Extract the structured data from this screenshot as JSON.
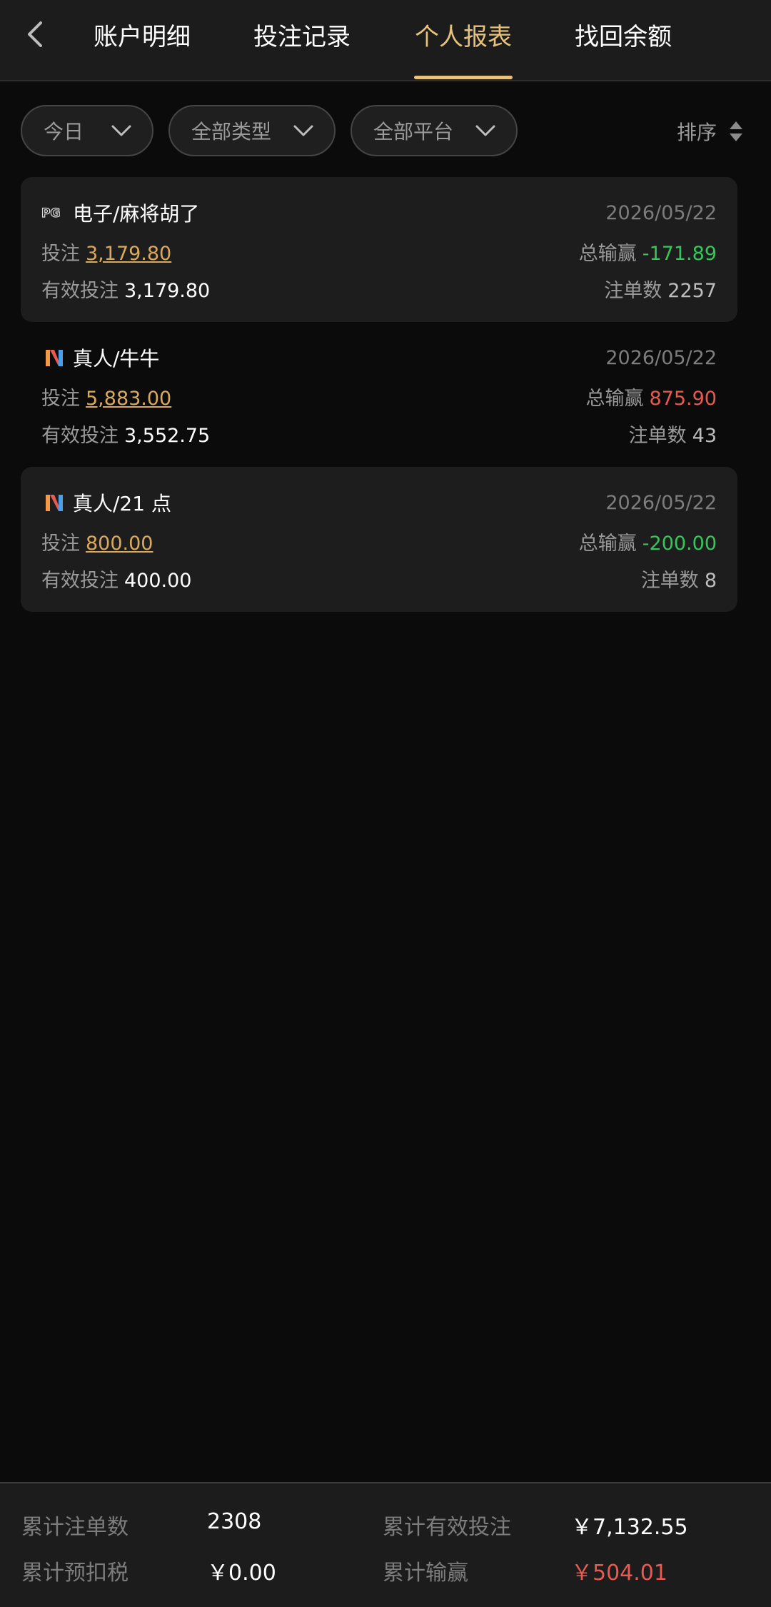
{
  "header": {
    "tabs": [
      {
        "label": "账户明细",
        "active": false
      },
      {
        "label": "投注记录",
        "active": false
      },
      {
        "label": "个人报表",
        "active": true
      },
      {
        "label": "找回余额",
        "active": false
      }
    ]
  },
  "filters": {
    "date": "今日",
    "type": "全部类型",
    "platform": "全部平台",
    "sort": "排序"
  },
  "labels": {
    "bet": "投注",
    "valid_bet": "有效投注",
    "total_win_loss": "总输赢",
    "order_count": "注单数"
  },
  "records": [
    {
      "icon": "pg-logo-icon",
      "game": "电子/麻将胡了",
      "date": "2026/05/22",
      "bet": "3,179.80",
      "valid_bet": "3,179.80",
      "win_loss": "-171.89",
      "win_loss_color": "#34c759",
      "order_count": "2257"
    },
    {
      "icon": "m-logo-icon",
      "game": "真人/牛牛",
      "date": "2026/05/22",
      "bet": "5,883.00",
      "valid_bet": "3,552.75",
      "win_loss": "875.90",
      "win_loss_color": "#e85a4f",
      "order_count": "43"
    },
    {
      "icon": "m-logo-icon",
      "game": "真人/21 点",
      "date": "2026/05/22",
      "bet": "800.00",
      "valid_bet": "400.00",
      "win_loss": "-200.00",
      "win_loss_color": "#34c759",
      "order_count": "8"
    }
  ],
  "summary": {
    "total_orders_label": "累计注单数",
    "total_orders": "2308",
    "total_valid_bet_label": "累计有效投注",
    "total_valid_bet": "￥7,132.55",
    "pre_tax_label": "累计预扣税",
    "pre_tax": "￥0.00",
    "total_win_loss_label": "累计输赢",
    "total_win_loss": "￥504.01"
  },
  "colors": {
    "accent": "#e6c27a",
    "gold_link": "#d9a95e",
    "loss_green": "#34c759",
    "win_red": "#e85a4f"
  }
}
